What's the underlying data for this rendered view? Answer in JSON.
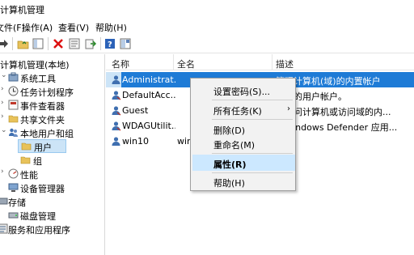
{
  "window": {
    "title": "计算机管理"
  },
  "menu": [
    "文件(F)",
    "操作(A)",
    "查看(V)",
    "帮助(H)"
  ],
  "toolbar": {
    "icons": [
      "back-arrow-icon",
      "forward-arrow-icon",
      "up-folder-icon",
      "show-tree-icon",
      "delete-icon",
      "properties-icon",
      "export-icon",
      "help-icon",
      "show-pane-icon"
    ]
  },
  "tree": {
    "root": "计算机管理(本地)",
    "items": [
      {
        "label": "系统工具",
        "icon": "tools-icon"
      },
      {
        "label": "任务计划程序",
        "icon": "clock-icon"
      },
      {
        "label": "事件查看器",
        "icon": "event-icon"
      },
      {
        "label": "共享文件夹",
        "icon": "shared-folder-icon"
      },
      {
        "label": "本地用户和组",
        "icon": "users-icon"
      },
      {
        "label": "用户",
        "icon": "folder-icon"
      },
      {
        "label": "组",
        "icon": "folder-icon"
      },
      {
        "label": "性能",
        "icon": "performance-icon"
      },
      {
        "label": "设备管理器",
        "icon": "device-icon"
      },
      {
        "label": "存储",
        "icon": "storage-icon"
      },
      {
        "label": "磁盘管理",
        "icon": "disk-icon"
      },
      {
        "label": "服务和应用程序",
        "icon": "services-icon"
      }
    ]
  },
  "list": {
    "columns": [
      "名称",
      "全名",
      "描述"
    ],
    "rows": [
      {
        "name": "Administrat...",
        "full": "",
        "desc": "管理计算机(域)的内置帐户"
      },
      {
        "name": "DefaultAcc...",
        "full": "",
        "desc": "管理的用户帐户。"
      },
      {
        "name": "Guest",
        "full": "",
        "desc": "宾访问计算机或访问域的内..."
      },
      {
        "name": "WDAGUtilit...",
        "full": "",
        "desc": "g Windows Defender 应用..."
      },
      {
        "name": "win10",
        "full": "win",
        "desc": ""
      }
    ]
  },
  "context_menu": {
    "items": [
      "设置密码(S)...",
      "所有任务(K)",
      "删除(D)",
      "重命名(M)",
      "属性(R)",
      "帮助(H)"
    ],
    "submenu_arrow": "›",
    "highlighted": "属性(R)"
  }
}
